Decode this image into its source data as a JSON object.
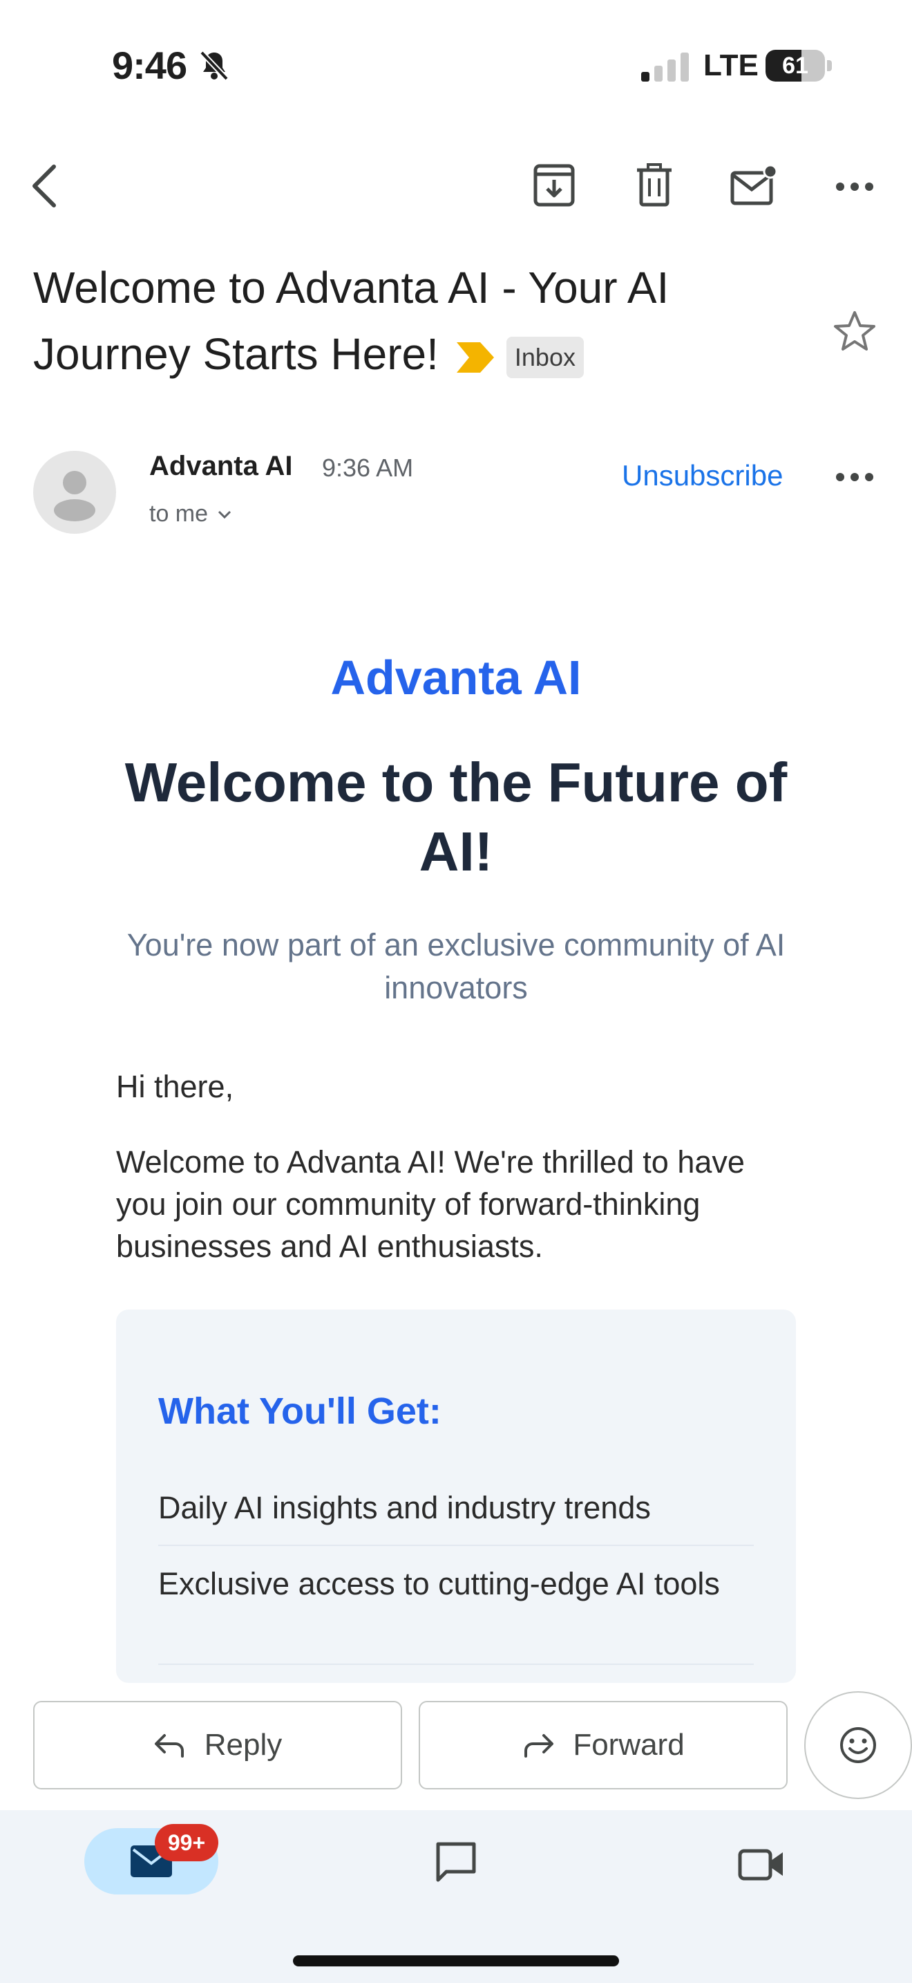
{
  "status_bar": {
    "time": "9:46",
    "network": "LTE",
    "battery_percent": "61",
    "battery_level": 0.61,
    "signal_bars_active": 1,
    "signal_bars_total": 4
  },
  "toolbar": {
    "back_icon": "chevron-left-icon",
    "archive_icon": "archive-icon",
    "delete_icon": "trash-icon",
    "mark_unread_icon": "mail-unread-icon",
    "more_icon": "more-horizontal-icon"
  },
  "email": {
    "subject": "Welcome to Advanta AI - Your AI Journey Starts Here!",
    "label": "Inbox",
    "starred": false,
    "sender": "Advanta AI",
    "time": "9:36 AM",
    "recipient": "to me",
    "unsubscribe_label": "Unsubscribe"
  },
  "content": {
    "brand": "Advanta AI",
    "hero_title": "Welcome to the Future of AI!",
    "hero_subtitle": "You're now part of an exclusive community of AI innovators",
    "greeting": "Hi there,",
    "intro": "Welcome to Advanta AI! We're thrilled to have you join our community of forward-thinking businesses and AI enthusiasts.",
    "benefits_title": "What You'll Get:",
    "benefits": [
      "Daily AI insights and industry trends",
      "Exclusive access to cutting-edge AI tools"
    ]
  },
  "actions": {
    "reply_label": "Reply",
    "forward_label": "Forward"
  },
  "bottom_nav": {
    "mail_badge": "99+",
    "mail_icon": "mail-icon",
    "chat_icon": "chat-icon",
    "meet_icon": "video-icon"
  },
  "colors": {
    "accent_blue": "#2563eb",
    "link_blue": "#1a73e8",
    "badge_red": "#d93025",
    "importance_yellow": "#f4b400",
    "nav_active": "#c3e7ff"
  }
}
